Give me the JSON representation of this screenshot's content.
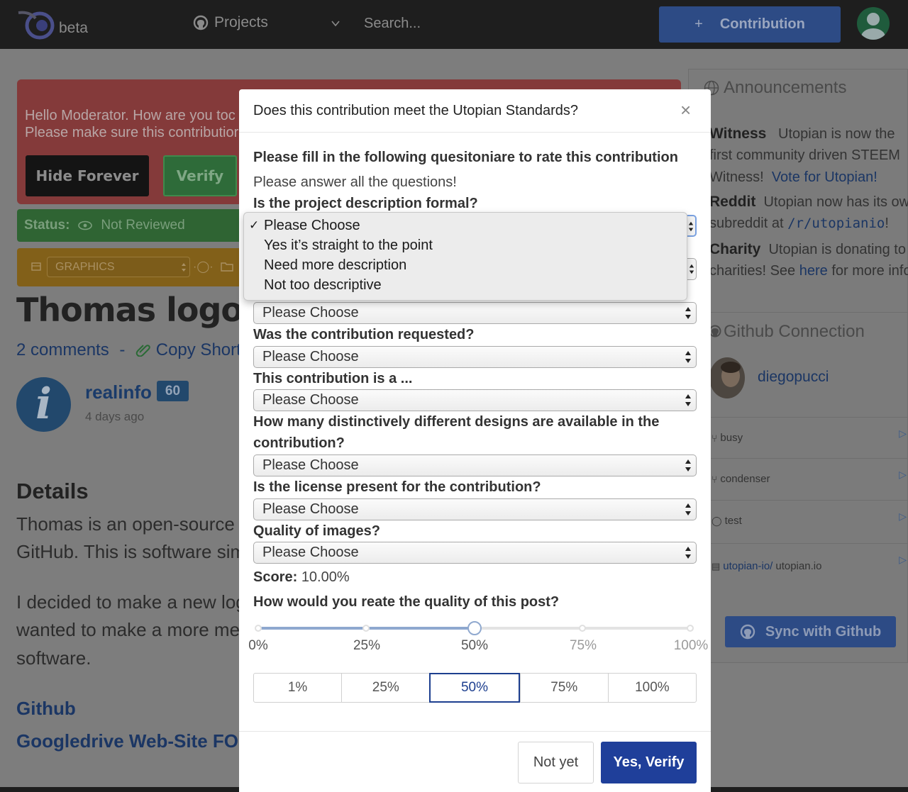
{
  "topbar": {
    "beta": "beta",
    "projects": "Projects",
    "search_placeholder": "Search...",
    "contribution_label": "Contribution",
    "contribution_plus": "+"
  },
  "background": {
    "alert_line1": "Hello Moderator. How are you toc",
    "alert_line2": "Please make sure this contributior",
    "hide_forever": "Hide Forever",
    "verify": "Verify",
    "status_label": "Status:",
    "status_value": "Not Reviewed",
    "category_select": "GRAPHICS",
    "title": "Thomas logo des",
    "comments": "2 comments",
    "comments_sep": "-",
    "copy_short": "Copy Short L",
    "author": "realinfo",
    "author_rep": "60",
    "author_time": "4 days ago",
    "author_avatar_glyph": "i",
    "details_heading": "Details",
    "body_line1": "Thomas is an open-source p",
    "body_line2": "GitHub. This is software simp",
    "body_line3": "I decided to make a new logo",
    "body_line4": "wanted to make a more mea",
    "body_line5": "software.",
    "link_github": "Github",
    "link_drive": "Googledrive Web-Site FONT"
  },
  "sidebar": {
    "announcements": "Announcements",
    "witness_bold": "Witness",
    "witness_text1": "Utopian is now the",
    "witness_text2": "first community driven STEEM",
    "witness_text3": "Witness!",
    "witness_link": "Vote for Utopian!",
    "reddit_bold": "Reddit",
    "reddit_text1": "Utopian now has its own",
    "reddit_text2": "subreddit at",
    "reddit_mono": "/r/utopianio",
    "reddit_end": "!",
    "charity_bold": "Charity",
    "charity_text1": "Utopian is donating to",
    "charity_text2": "charities! See",
    "charity_link": "here",
    "charity_text3": "for more info.",
    "github_connection": "Github Connection",
    "gh_user": "diegopucci",
    "repos": [
      "busy",
      "condenser",
      "test"
    ],
    "repo_owner": "utopian-io/",
    "repo_name": "utopian.io",
    "sync": "Sync with Github"
  },
  "modal": {
    "title": "Does this contribution meet the Utopian Standards?",
    "close": "×",
    "intro": "Please fill in the following quesitoniare to rate this contribution",
    "note": "Please answer all the questions!",
    "q1": "Is the project description formal?",
    "q2_select": "Please Choose",
    "q3": "Was the contribution requested?",
    "q3_select": "Please Choose",
    "q4": "This contribution is a ...",
    "q4_select": "Please Choose",
    "q5_line1": "How many distinctively different designs are available in the",
    "q5_line2": "contribution?",
    "q5_select": "Please Choose",
    "q6": "Is the license present for the contribution?",
    "q6_select": "Please Choose",
    "q7": "Quality of images?",
    "q7_select": "Please Choose",
    "score_label": "Score:",
    "score_value": "10.00%",
    "quality_question": "How would you reate the quality of this post?",
    "slider_value_percent": 50,
    "slider_marks": [
      "0%",
      "25%",
      "50%",
      "75%",
      "100%"
    ],
    "segments": [
      "1%",
      "25%",
      "50%",
      "75%",
      "100%"
    ],
    "segment_selected": "50%",
    "not_yet": "Not yet",
    "yes_verify": "Yes, Verify"
  },
  "dropdown": {
    "check": "✓",
    "options": [
      "Please Choose",
      "Yes it’s straight to the point",
      "Need more description",
      "Not too descriptive"
    ],
    "selected": "Please Choose"
  },
  "colors": {
    "topbar": "#1e1e1e",
    "primary_button": "#1f3f9a",
    "overlay_gray": "#7d7d7d",
    "slider_active": "#8ea8cf"
  }
}
